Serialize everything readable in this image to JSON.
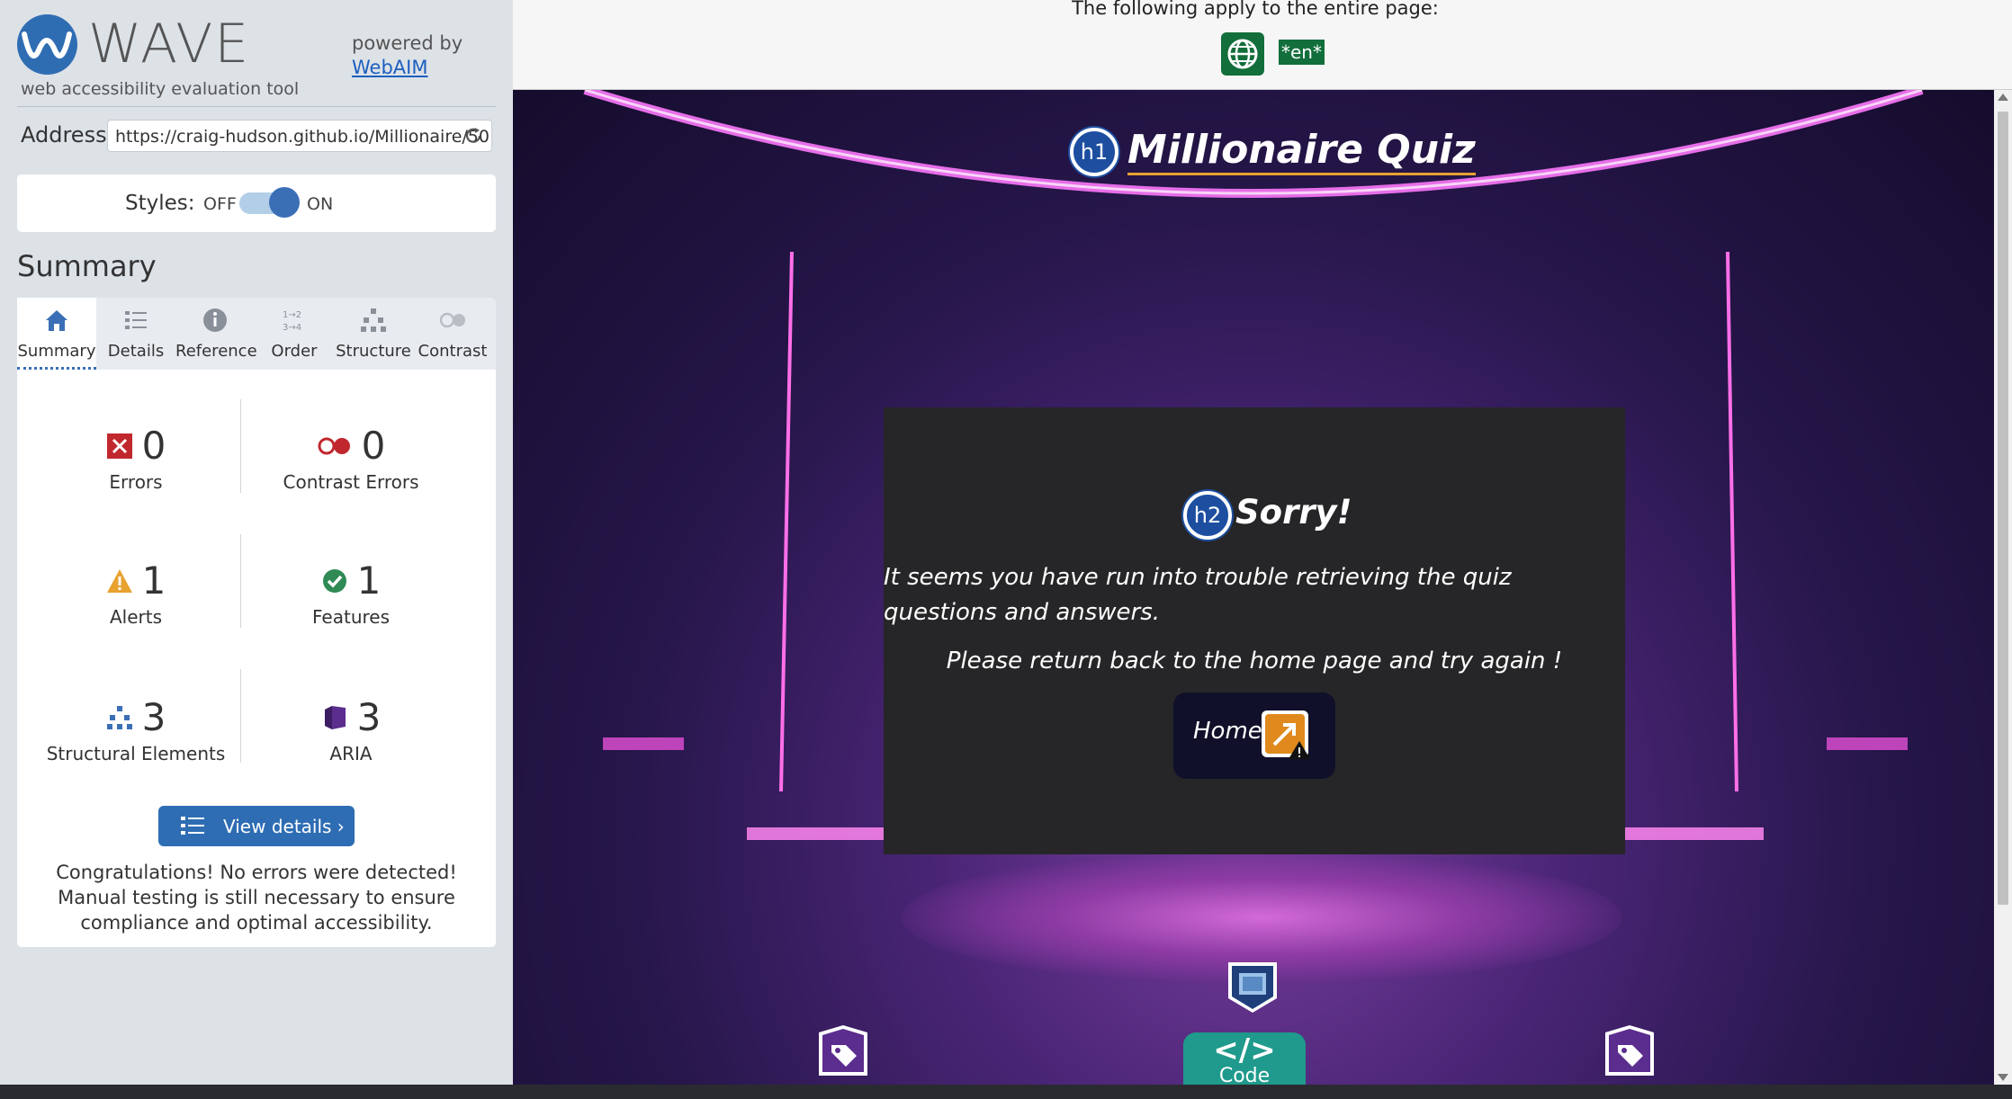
{
  "sidebar": {
    "logo_text": "WAVE",
    "logo_subtitle": "web accessibility evaluation tool",
    "powered_by": "powered by",
    "webaim_link": "WebAIM",
    "address_label": "Address:",
    "address_value": "https://craig-hudson.github.io/Millionaire/50",
    "styles_label": "Styles:",
    "styles_off": "OFF",
    "styles_on": "ON",
    "styles_enabled": true,
    "summary_title": "Summary",
    "tabs": [
      {
        "label": "Summary",
        "icon": "home-icon",
        "active": true
      },
      {
        "label": "Details",
        "icon": "list-icon",
        "active": false
      },
      {
        "label": "Reference",
        "icon": "info-icon",
        "active": false
      },
      {
        "label": "Order",
        "icon": "order-icon",
        "active": false
      },
      {
        "label": "Structure",
        "icon": "structure-icon",
        "active": false
      },
      {
        "label": "Contrast",
        "icon": "contrast-icon",
        "active": false
      }
    ],
    "stats": {
      "errors": {
        "count": "0",
        "label": "Errors",
        "color": "#c0282d"
      },
      "contrast_errors": {
        "count": "0",
        "label": "Contrast Errors",
        "color": "#c0282d"
      },
      "alerts": {
        "count": "1",
        "label": "Alerts",
        "color": "#e7a230"
      },
      "features": {
        "count": "1",
        "label": "Features",
        "color": "#2f8a56"
      },
      "structural": {
        "count": "3",
        "label": "Structural Elements",
        "color": "#3a6fb6"
      },
      "aria": {
        "count": "3",
        "label": "ARIA",
        "color": "#5b2d8e"
      }
    },
    "view_details_label": "View details ›",
    "congrats_text": "Congratulations! No errors were detected! Manual testing is still necessary to ensure compliance and optimal accessibility."
  },
  "topbar": {
    "apply_text": "The following apply to the entire page:",
    "lang_badge": "*en*",
    "globe_icon": "globe-icon"
  },
  "page": {
    "h1_badge": "h1",
    "h1_text": "Millionaire Quiz",
    "h2_badge": "h2",
    "h2_text": "Sorry!",
    "message_1": "It seems you have run into trouble retrieving the quiz questions and answers.",
    "message_2": "Please return back to the home page and try again !",
    "home_button": "Home",
    "code_badge_symbol": "</>",
    "code_badge_text": "Code"
  },
  "colors": {
    "wave_blue": "#2e6db3",
    "feature_green": "#126e3b",
    "aria_teal": "#1f9a8c",
    "heading_underline": "#e7a230"
  }
}
